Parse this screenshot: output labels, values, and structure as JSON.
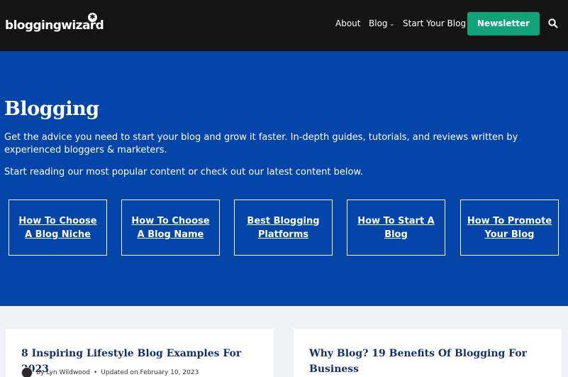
{
  "header": {
    "logo_text": "bloggingwizard",
    "nav": [
      {
        "label": "About"
      },
      {
        "label": "Blog"
      },
      {
        "label": "Start Your Blog"
      }
    ],
    "newsletter_label": "Newsletter",
    "icons": {
      "search": "search-icon",
      "dropdown": "chevron-down-icon"
    },
    "colors": {
      "bar": "#141414",
      "newsletter": "#10a37a"
    }
  },
  "hero": {
    "title": "Blogging",
    "description": "Get the advice you need to start your blog and grow it faster. In-depth guides, tutorials, and reviews written by experienced bloggers & marketers.",
    "cta": "Start reading our most popular content or check out our latest content below.",
    "topics": [
      {
        "label": "How To Choose A Blog Niche"
      },
      {
        "label": "How To Choose A Blog Name"
      },
      {
        "label": "Best Blogging Platforms"
      },
      {
        "label": "How To Start A Blog"
      },
      {
        "label": "How To Promote Your Blog"
      }
    ],
    "colors": {
      "background": "#0345a8"
    }
  },
  "posts": [
    {
      "title": "8 Inspiring Lifestyle Blog Examples For 2023",
      "author": "By Lyn Wildwood",
      "updated": "Updated on February 10, 2023"
    },
    {
      "title": "Why Blog? 19 Benefits Of Blogging For Business"
    }
  ]
}
